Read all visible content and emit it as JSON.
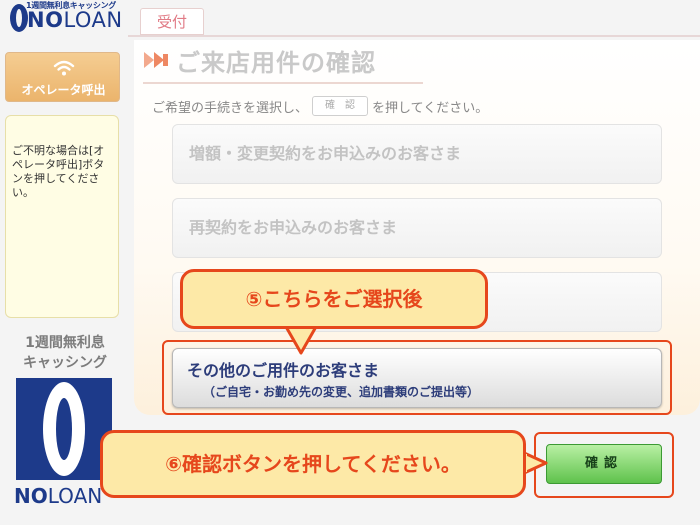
{
  "logo": {
    "tagline": "1週間無利息キャッシング",
    "brand_no": "NO",
    "brand_loan": "LOAN"
  },
  "header": {
    "tab_label": "受付"
  },
  "sidebar": {
    "operator_button_label": "オペレータ呼出",
    "help_text": "ご不明な場合は[オペレータ呼出]ボタンを押してください。",
    "promo_line1": "1週間無利息",
    "promo_line2": "キャッシング",
    "brand_no": "NO",
    "brand_loan": "LOAN"
  },
  "main": {
    "title": "ご来店用件の確認",
    "instruction_before": "ご希望の手続きを選択し、",
    "instruction_button": "確　認",
    "instruction_after": "を押してください。",
    "options": [
      {
        "label": "増額・変更契約をお申込みのお客さま"
      },
      {
        "label": "再契約をお申込みのお客さま"
      },
      {
        "label": ""
      }
    ],
    "selected_option": {
      "label": "その他のご用件のお客さま",
      "sublabel": "（ご自宅・お勤め先の変更、追加書類のご提出等）"
    }
  },
  "callouts": {
    "step5": "⑤こちらをご選択後",
    "step6": "⑥確認ボタンを押してください。"
  },
  "confirm_button_label": "確認",
  "colors": {
    "brand_blue": "#1d3a8a",
    "highlight_red": "#e6471c",
    "callout_fill": "#fde9a7",
    "confirm_green": "#5fc24c",
    "operator_orange": "#ebb46c"
  }
}
